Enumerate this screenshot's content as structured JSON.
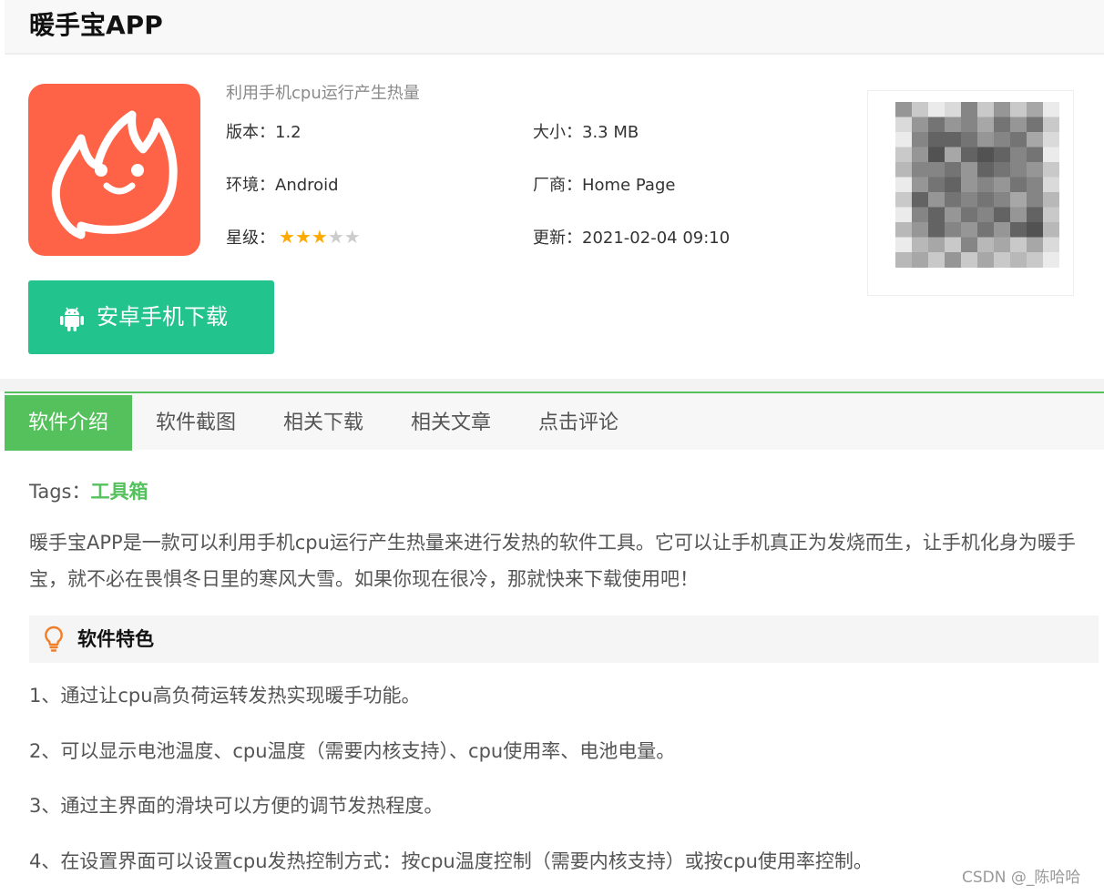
{
  "header": {
    "title": "暖手宝APP"
  },
  "app": {
    "icon": "flame-mascot-icon",
    "icon_bg": "#ff6347",
    "subtitle": "利用手机cpu运行产生热量",
    "version_label": "版本：",
    "version": "1.2",
    "size_label": "大小：",
    "size": "3.3 MB",
    "env_label": "环境：",
    "env": "Android",
    "vendor_label": "厂商：",
    "vendor": "Home Page",
    "rating_label": "星级：",
    "rating": 3,
    "rating_max": 5,
    "updated_label": "更新：",
    "updated": "2021-02-04 09:10"
  },
  "download": {
    "label": "安卓手机下载",
    "icon": "android-icon",
    "color": "#23c38d"
  },
  "qr": {
    "icon": "qr-code-blurred"
  },
  "tabs": [
    {
      "label": "软件介绍",
      "active": true
    },
    {
      "label": "软件截图",
      "active": false
    },
    {
      "label": "相关下载",
      "active": false
    },
    {
      "label": "相关文章",
      "active": false
    },
    {
      "label": "点击评论",
      "active": false
    }
  ],
  "accent": "#54c15c",
  "tags": {
    "label": "Tags：",
    "items": [
      "工具箱"
    ]
  },
  "intro": "暖手宝APP是一款可以利用手机cpu运行产生热量来进行发热的软件工具。它可以让手机真正为发烧而生，让手机化身为暖手宝，就不必在畏惧冬日里的寒风大雪。如果你现在很冷，那就快来下载使用吧！",
  "features": {
    "title": "软件特色",
    "icon": "lightbulb-icon",
    "items": [
      "1、通过让cpu高负荷运转发热实现暖手功能。",
      "2、可以显示电池温度、cpu温度（需要内核支持）、cpu使用率、电池电量。",
      "3、通过主界面的滑块可以方便的调节发热程度。",
      "4、在设置界面可以设置cpu发热控制方式：按cpu温度控制（需要内核支持）或按cpu使用率控制。"
    ]
  },
  "watermark": "CSDN @_陈哈哈"
}
